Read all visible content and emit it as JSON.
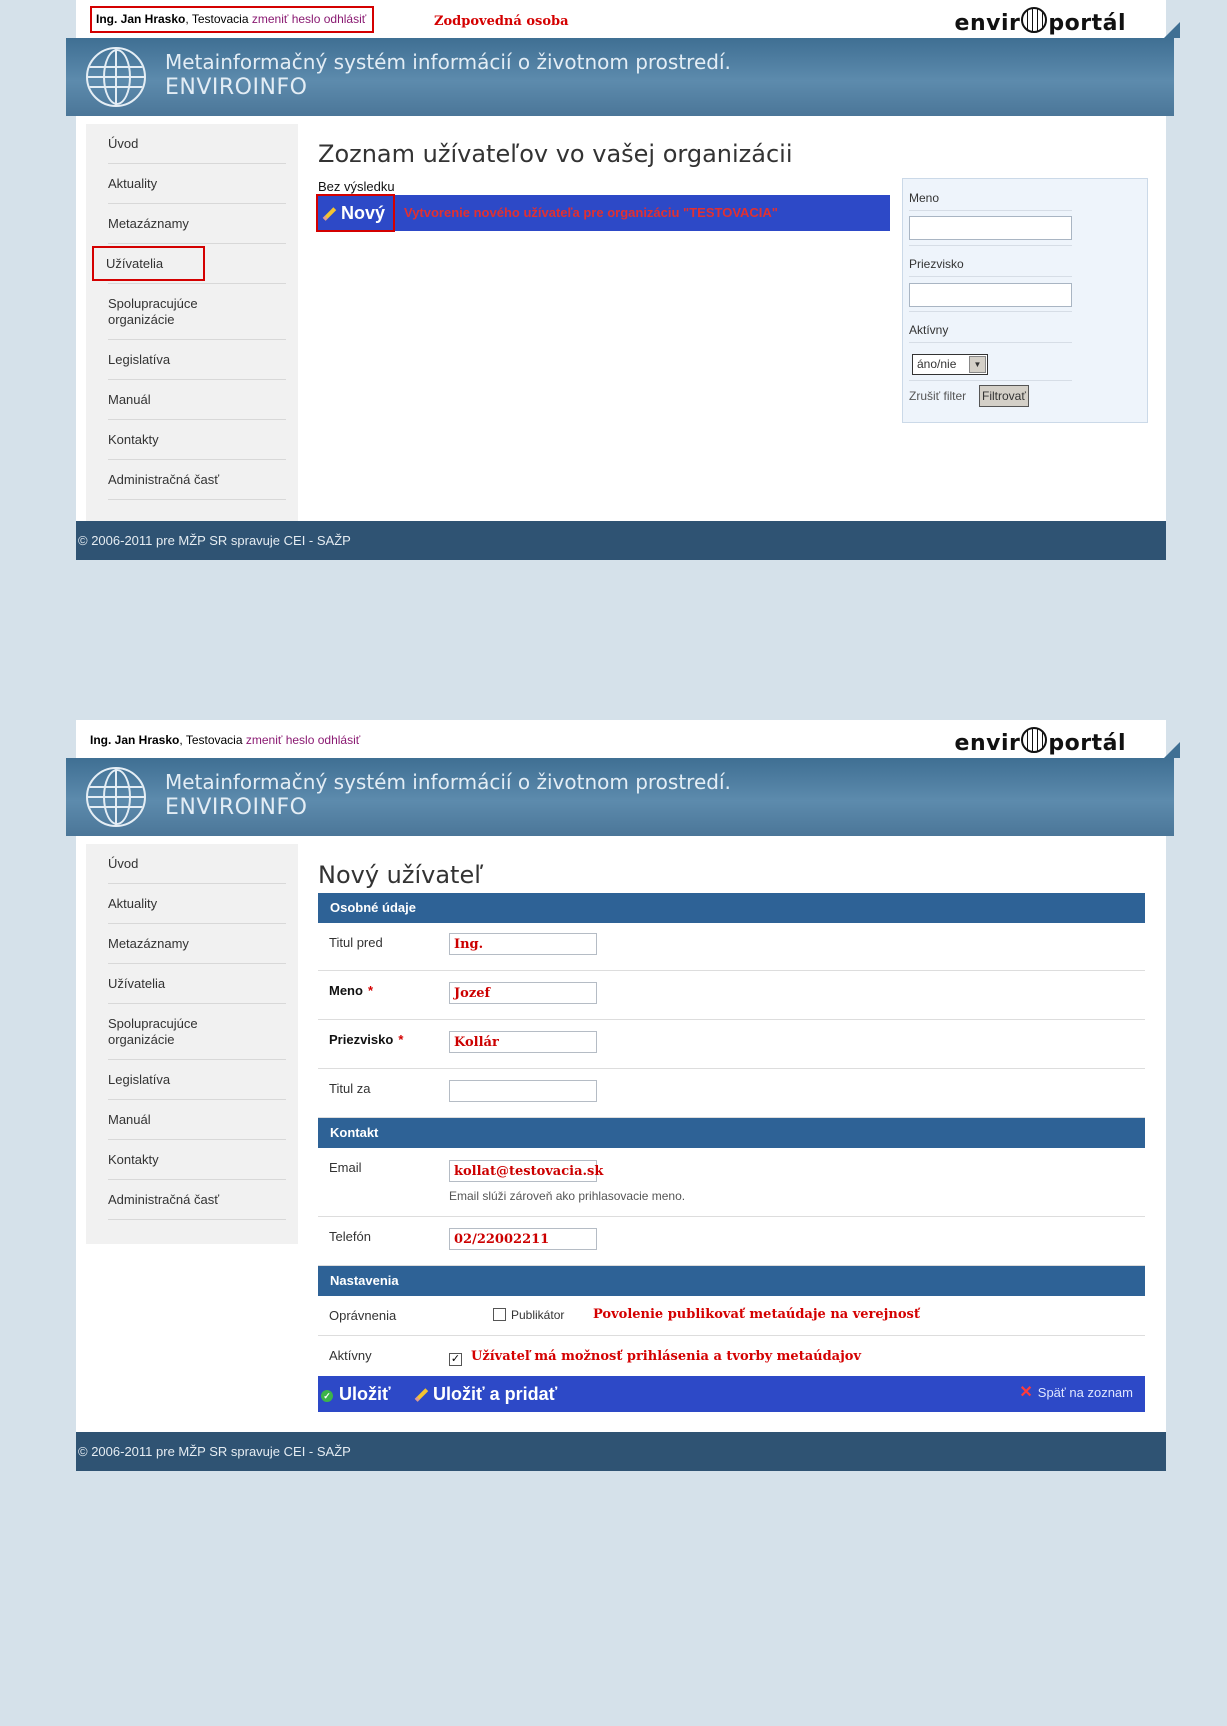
{
  "header": {
    "user_name": "Ing. Jan Hrasko",
    "org": ", Testovacia ",
    "change_password": "zmeniť heslo",
    "logout": "odhlásiť",
    "logo_left": "envir",
    "logo_right": "portál",
    "banner_line1": "Metainformačný systém informácií o životnom prostredí.",
    "banner_line2": "ENVIROINFO"
  },
  "annotations": {
    "responsible_person": "Zodpovedná osoba",
    "new_user_note": "Vytvorenie nového užívateľa pre organizáciu \"TESTOVACIA\"",
    "publisher_note": "Povolenie publikovať metaúdaje na verejnosť",
    "active_note": "Užívateľ má možnosť prihlásenia a tvorby metaúdajov"
  },
  "sidebar": {
    "items": [
      {
        "label": "Úvod"
      },
      {
        "label": "Aktuality"
      },
      {
        "label": "Metazáznamy"
      },
      {
        "label": "Užívatelia"
      },
      {
        "label": "Spolupracujúce organizácie"
      },
      {
        "label": "Legislatíva"
      },
      {
        "label": "Manuál"
      },
      {
        "label": "Kontakty"
      },
      {
        "label": "Administračná časť"
      }
    ]
  },
  "footer": {
    "text": "© 2006-2011 pre MŽP SR spravuje CEI - SAŽP"
  },
  "list_page": {
    "title": "Zoznam užívateľov vo vašej organizácii",
    "no_result": "Bez výsledku",
    "new_button": "Nový"
  },
  "filter": {
    "name_label": "Meno",
    "surname_label": "Priezvisko",
    "active_label": "Aktívny",
    "active_select_value": "áno/nie",
    "cancel_filter": "Zrušiť filter",
    "filter_button": "Filtrovať"
  },
  "form_page": {
    "title": "Nový užívateľ",
    "section_personal": "Osobné údaje",
    "title_before_label": "Titul pred",
    "title_before_value": "Ing.",
    "name_label": "Meno",
    "name_value": "Jozef",
    "surname_label": "Priezvisko",
    "surname_value": "Kollár",
    "title_after_label": "Titul za",
    "title_after_value": "",
    "required_mark": "*",
    "section_contact": "Kontakt",
    "email_label": "Email",
    "email_value": "kollat@testovacia.sk",
    "email_hint": "Email slúži zároveň ako prihlasovacie meno.",
    "phone_label": "Telefón",
    "phone_value": "02/22002211",
    "section_settings": "Nastavenia",
    "permissions_label": "Oprávnenia",
    "publisher_label": "Publikátor",
    "publisher_checked": false,
    "active_label": "Aktívny",
    "active_checked": true,
    "save_button": "Uložiť",
    "save_add_button": "Uložiť a pridať",
    "back_link": "Späť na zoznam"
  },
  "colors": {
    "page_bg": "#d5e1ea",
    "banner": "#4b7698",
    "section_header": "#2e6296",
    "action_bar": "#2d49c7",
    "annotation_red": "#d40000",
    "footer": "#2f5373"
  }
}
